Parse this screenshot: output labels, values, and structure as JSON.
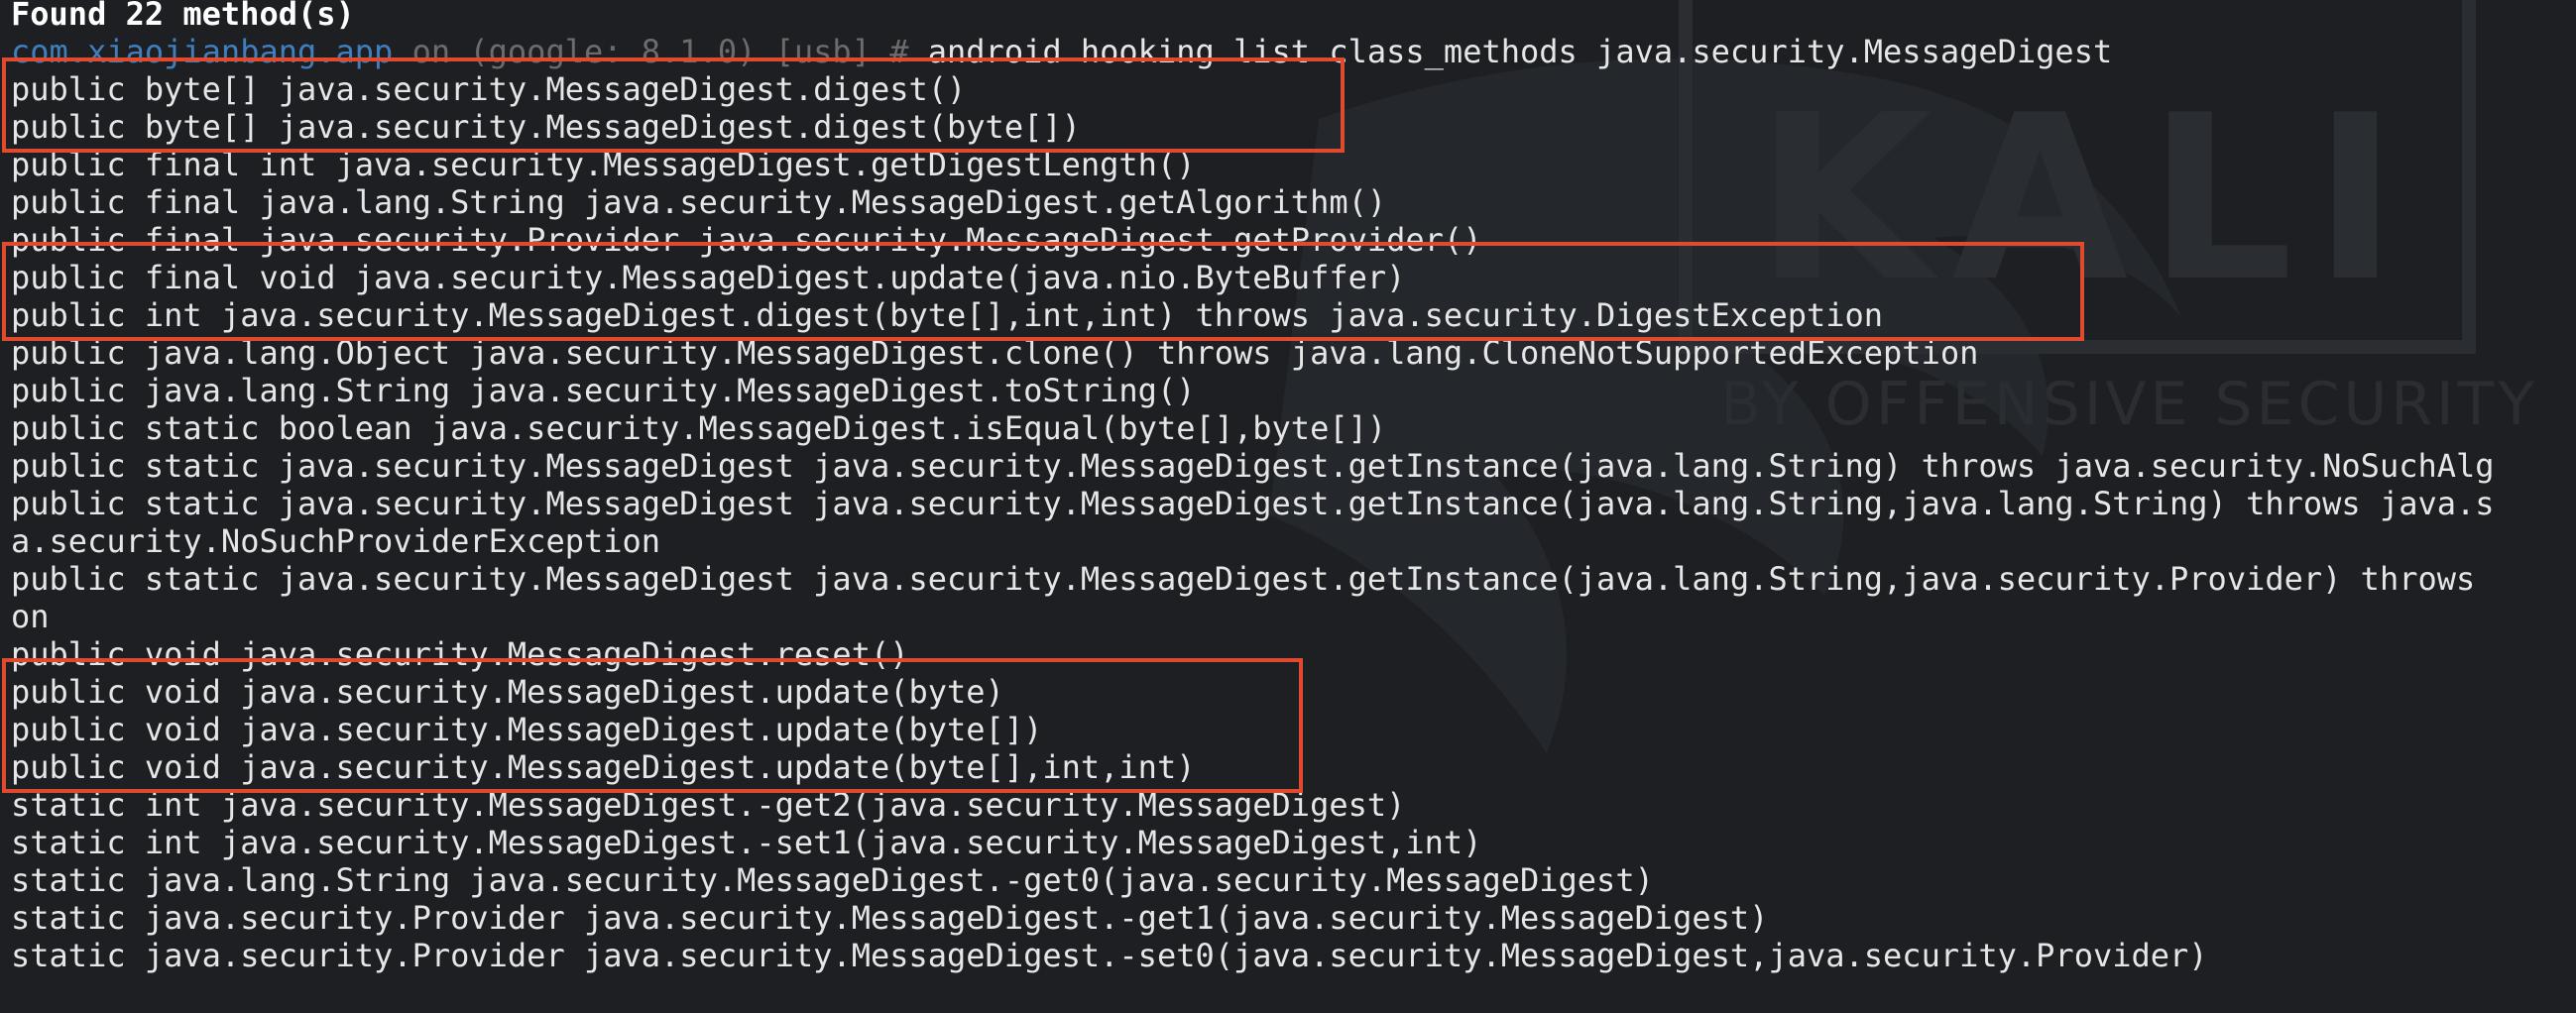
{
  "prompt": {
    "host": "com.xiaojianbang.app",
    "mid": " on (google: 8.1.0) [usb] # ",
    "command": "android hooking list class_methods java.security.MessageDigest"
  },
  "watermark": {
    "logo_text": "KALI",
    "tagline": "BY OFFENSIVE SECURITY"
  },
  "colors": {
    "highlight": "#e04a2f",
    "prompt_host": "#3f7fbd",
    "background": "#1d1f22"
  },
  "output": {
    "header": "Found 22 method(s)",
    "lines": [
      "public byte[] java.security.MessageDigest.digest()",
      "public byte[] java.security.MessageDigest.digest(byte[])",
      "public final int java.security.MessageDigest.getDigestLength()",
      "public final java.lang.String java.security.MessageDigest.getAlgorithm()",
      "public final java.security.Provider java.security.MessageDigest.getProvider()",
      "public final void java.security.MessageDigest.update(java.nio.ByteBuffer)",
      "public int java.security.MessageDigest.digest(byte[],int,int) throws java.security.DigestException",
      "public java.lang.Object java.security.MessageDigest.clone() throws java.lang.CloneNotSupportedException",
      "public java.lang.String java.security.MessageDigest.toString()",
      "public static boolean java.security.MessageDigest.isEqual(byte[],byte[])",
      "public static java.security.MessageDigest java.security.MessageDigest.getInstance(java.lang.String) throws java.security.NoSuchAlg",
      "public static java.security.MessageDigest java.security.MessageDigest.getInstance(java.lang.String,java.lang.String) throws java.s",
      "a.security.NoSuchProviderException",
      "public static java.security.MessageDigest java.security.MessageDigest.getInstance(java.lang.String,java.security.Provider) throws",
      "on",
      "public void java.security.MessageDigest.reset()",
      "public void java.security.MessageDigest.update(byte)",
      "public void java.security.MessageDigest.update(byte[])",
      "public void java.security.MessageDigest.update(byte[],int,int)",
      "static int java.security.MessageDigest.-get2(java.security.MessageDigest)",
      "static int java.security.MessageDigest.-set1(java.security.MessageDigest,int)",
      "static java.lang.String java.security.MessageDigest.-get0(java.security.MessageDigest)",
      "static java.security.Provider java.security.MessageDigest.-get1(java.security.MessageDigest)",
      "static java.security.Provider java.security.MessageDigest.-set0(java.security.MessageDigest,java.security.Provider)"
    ]
  }
}
